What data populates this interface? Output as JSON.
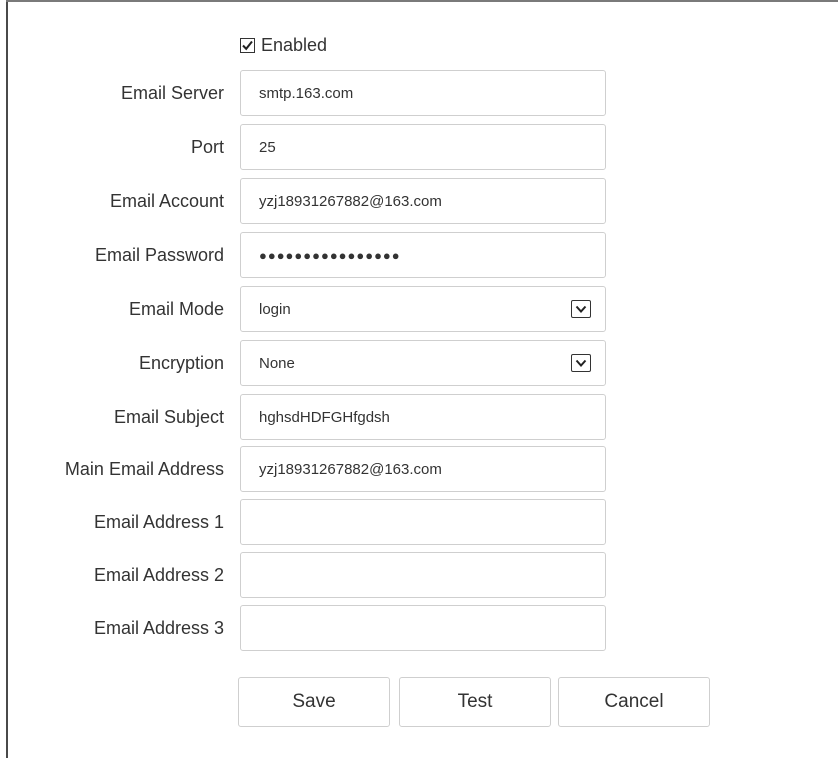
{
  "enabled": {
    "label": "Enabled",
    "checked": true
  },
  "fields": {
    "email_server": {
      "label": "Email Server",
      "value": "smtp.163.com"
    },
    "port": {
      "label": "Port",
      "value": "25"
    },
    "email_account": {
      "label": "Email Account",
      "value": "yzj18931267882@163.com"
    },
    "email_password": {
      "label": "Email Password",
      "value": "●●●●●●●●●●●●●●●●"
    },
    "email_mode": {
      "label": "Email Mode",
      "value": "login"
    },
    "encryption": {
      "label": "Encryption",
      "value": "None"
    },
    "email_subject": {
      "label": "Email Subject",
      "value": "hghsdHDFGHfgdsh"
    },
    "main_email_address": {
      "label": "Main Email Address",
      "value": "yzj18931267882@163.com"
    },
    "email_address_1": {
      "label": "Email Address 1",
      "value": ""
    },
    "email_address_2": {
      "label": "Email Address 2",
      "value": ""
    },
    "email_address_3": {
      "label": "Email Address 3",
      "value": ""
    }
  },
  "buttons": {
    "save": "Save",
    "test": "Test",
    "cancel": "Cancel"
  },
  "icons": {
    "checkbox": "checkmark-icon",
    "select": "chevron-down-icon"
  }
}
